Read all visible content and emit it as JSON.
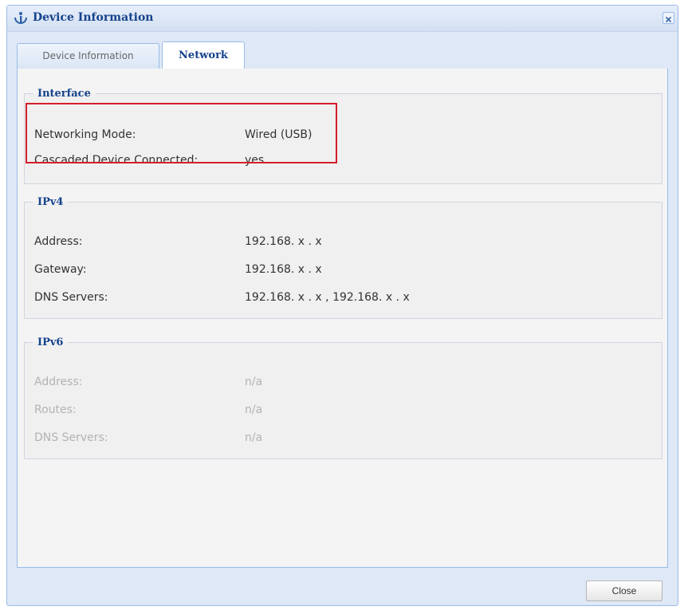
{
  "window": {
    "title": "Device Information",
    "close_icon": "close-icon",
    "info_icon": "info-icon"
  },
  "tabs": [
    {
      "label": "Device Information",
      "active": false
    },
    {
      "label": "Network",
      "active": true
    }
  ],
  "interface": {
    "legend": "Interface",
    "rows": [
      {
        "label": "Networking Mode:",
        "value": "Wired (USB)"
      },
      {
        "label": "Cascaded Device Connected:",
        "value": "yes"
      }
    ]
  },
  "ipv4": {
    "legend": "IPv4",
    "rows": [
      {
        "label": "Address:",
        "value": "192.168. x . x"
      },
      {
        "label": "Gateway:",
        "value": "192.168. x . x"
      },
      {
        "label": "DNS Servers:",
        "value": "192.168. x . x , 192.168. x . x"
      }
    ]
  },
  "ipv6": {
    "legend": "IPv6",
    "rows": [
      {
        "label": "Address:",
        "value": "n/a"
      },
      {
        "label": "Routes:",
        "value": "n/a"
      },
      {
        "label": "DNS Servers:",
        "value": "n/a"
      }
    ]
  },
  "footer": {
    "close_label": "Close"
  },
  "colors": {
    "title_text": "#15428b",
    "highlight_border": "#d41f2b",
    "window_background": "#dfe8f6"
  }
}
